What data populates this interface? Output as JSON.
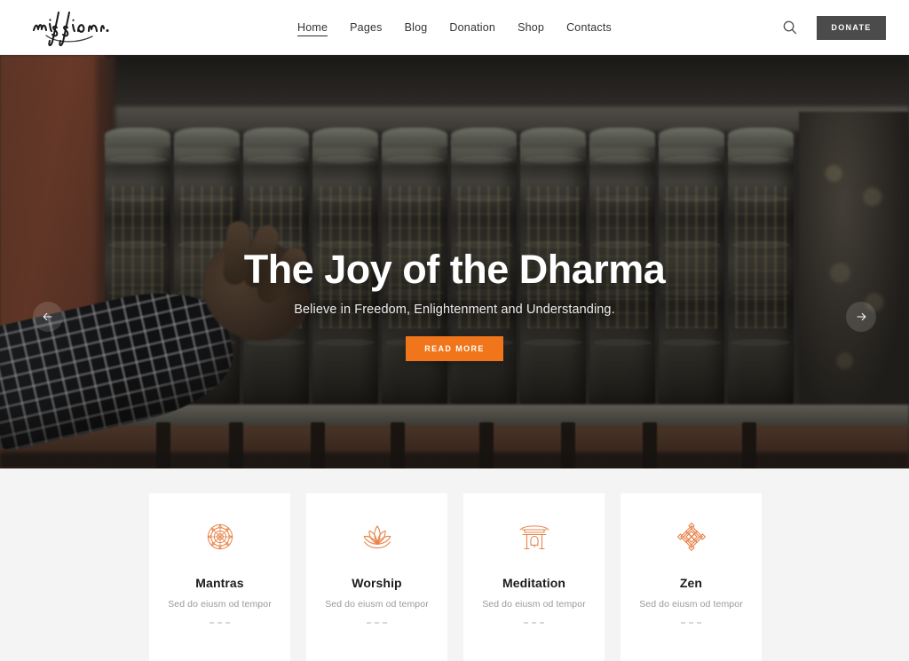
{
  "header": {
    "logo_text": "mission.",
    "logo_icon": "script-wordmark-logo",
    "nav": [
      {
        "label": "Home",
        "active": true
      },
      {
        "label": "Pages",
        "active": false
      },
      {
        "label": "Blog",
        "active": false
      },
      {
        "label": "Donation",
        "active": false
      },
      {
        "label": "Shop",
        "active": false
      },
      {
        "label": "Contacts",
        "active": false
      }
    ],
    "search_icon": "search-icon",
    "donate_label": "DONATE",
    "donate_color": "#4b4b4b"
  },
  "hero": {
    "title": "The Joy of the Dharma",
    "subtitle": "Believe in Freedom, Enlightenment and Understanding.",
    "cta_label": "READ MORE",
    "cta_color": "#f1761b",
    "prev_icon": "arrow-left-icon",
    "next_icon": "arrow-right-icon",
    "image_description": "Row of Tibetan prayer wheels with a hand reaching out"
  },
  "features": {
    "background": "#f4f4f4",
    "accent_color": "#e8834a",
    "cards": [
      {
        "title": "Mantras",
        "desc": "Sed do eiusm od tempor",
        "icon": "mandala-icon"
      },
      {
        "title": "Worship",
        "desc": "Sed do eiusm od tempor",
        "icon": "lotus-icon"
      },
      {
        "title": "Meditation",
        "desc": "Sed do eiusm od tempor",
        "icon": "temple-gate-bell-icon"
      },
      {
        "title": "Zen",
        "desc": "Sed do eiusm od tempor",
        "icon": "endless-knot-icon"
      }
    ]
  }
}
